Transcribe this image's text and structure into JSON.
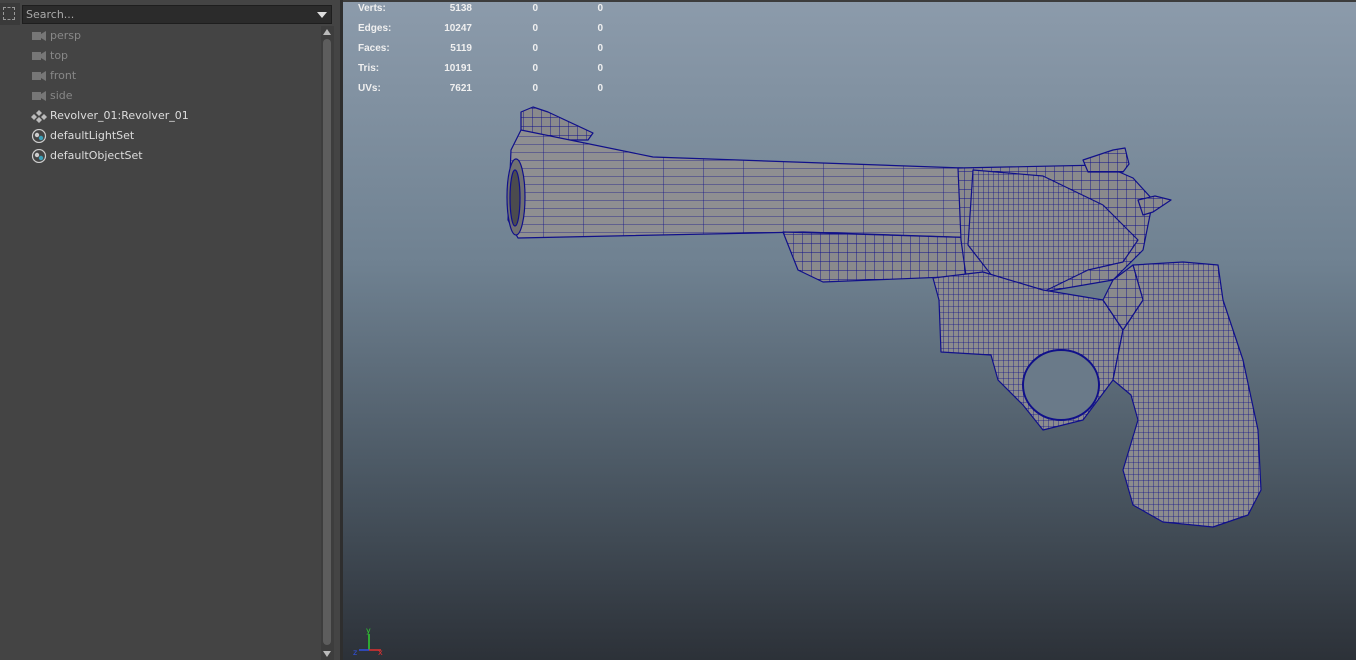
{
  "outliner": {
    "search_placeholder": "Search...",
    "items": [
      {
        "label": "persp",
        "icon": "camera-icon",
        "kind": "camera"
      },
      {
        "label": "top",
        "icon": "camera-icon",
        "kind": "camera"
      },
      {
        "label": "front",
        "icon": "camera-icon",
        "kind": "camera"
      },
      {
        "label": "side",
        "icon": "camera-icon",
        "kind": "camera"
      },
      {
        "label": "Revolver_01:Revolver_01",
        "icon": "transform-icon",
        "kind": "object"
      },
      {
        "label": "defaultLightSet",
        "icon": "set-icon",
        "kind": "object"
      },
      {
        "label": "defaultObjectSet",
        "icon": "set-icon",
        "kind": "object"
      }
    ]
  },
  "viewport": {
    "hud": [
      {
        "name": "Verts:",
        "v1": "5138",
        "v2": "0",
        "v3": "0"
      },
      {
        "name": "Edges:",
        "v1": "10247",
        "v2": "0",
        "v3": "0"
      },
      {
        "name": "Faces:",
        "v1": "5119",
        "v2": "0",
        "v3": "0"
      },
      {
        "name": "Tris:",
        "v1": "10191",
        "v2": "0",
        "v3": "0"
      },
      {
        "name": "UVs:",
        "v1": "7621",
        "v2": "0",
        "v3": "0"
      }
    ],
    "axis_labels": {
      "y": "y",
      "x": "x",
      "z": "z"
    },
    "wire_color": "#10108a",
    "shade_color": "#8a8a8c"
  }
}
